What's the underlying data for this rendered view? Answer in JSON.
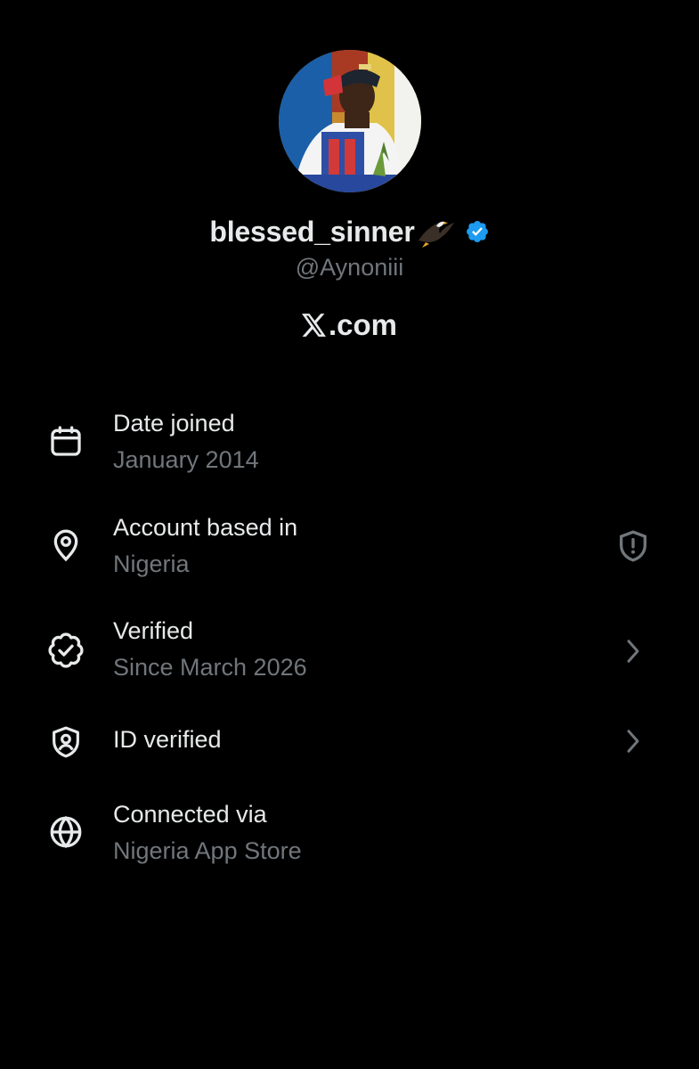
{
  "profile": {
    "display_name": "blessed_sinner",
    "handle": "@Aynoniii",
    "site_suffix": ".com",
    "name_emoji": "eagle-icon",
    "verified_badge_color": "#1d9bf0"
  },
  "rows": [
    {
      "title": "Date joined",
      "value": "January 2014",
      "icon": "calendar-icon"
    },
    {
      "title": "Account based in",
      "value": "Nigeria",
      "icon": "location-pin-icon",
      "action_icon": "shield-alert-icon"
    },
    {
      "title": "Verified",
      "value": "Since March 2026",
      "icon": "verified-badge-outline-icon",
      "action_icon": "chevron-right-icon"
    },
    {
      "title": "ID verified",
      "icon": "id-shield-icon",
      "action_icon": "chevron-right-icon"
    },
    {
      "title": "Connected via",
      "value": "Nigeria App Store",
      "icon": "globe-icon"
    }
  ],
  "colors": {
    "background": "#000000",
    "primary_text": "#e7e9ea",
    "secondary_text": "#71767b",
    "accent": "#1d9bf0"
  }
}
